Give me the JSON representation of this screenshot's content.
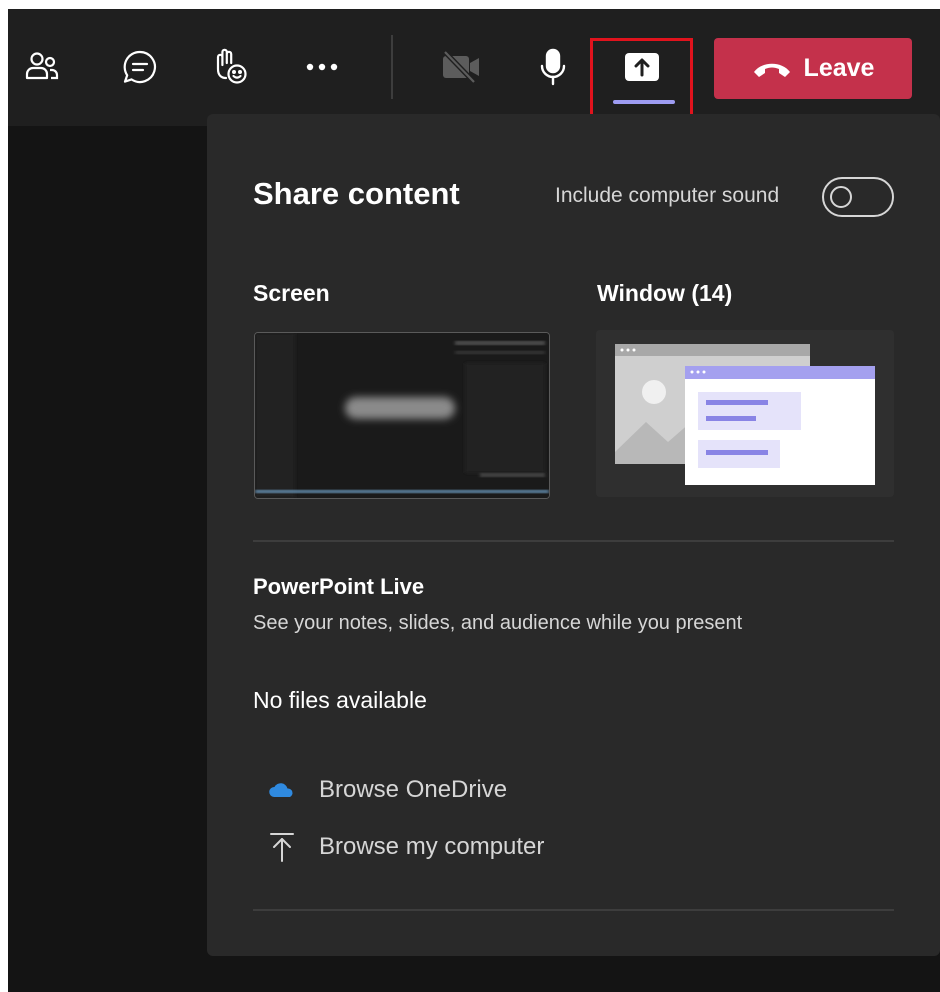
{
  "toolbar": {
    "buttons": [
      {
        "icon": "people-icon"
      },
      {
        "icon": "chat-icon"
      },
      {
        "icon": "reactions-icon"
      },
      {
        "icon": "more-options-icon"
      },
      {
        "icon": "camera-off-icon"
      },
      {
        "icon": "microphone-icon"
      },
      {
        "icon": "share-screen-icon",
        "active": true
      }
    ],
    "leave": {
      "label": "Leave",
      "icon": "hang-up-icon",
      "color": "#c4314b"
    },
    "highlight_color": "#e0131d",
    "active_indicator_color": "#9e9cf2"
  },
  "share_panel": {
    "title": "Share content",
    "include_sound_label": "Include computer sound",
    "include_sound_on": false,
    "screen_label": "Screen",
    "window_label": "Window (14)",
    "powerpoint": {
      "title": "PowerPoint Live",
      "subtitle": "See your notes, slides, and audience while you present"
    },
    "no_files": "No files available",
    "browse_onedrive": {
      "label": "Browse OneDrive",
      "icon": "onedrive-cloud-icon",
      "color": "#2f8ae0"
    },
    "browse_computer": {
      "label": "Browse my computer",
      "icon": "upload-icon"
    }
  }
}
